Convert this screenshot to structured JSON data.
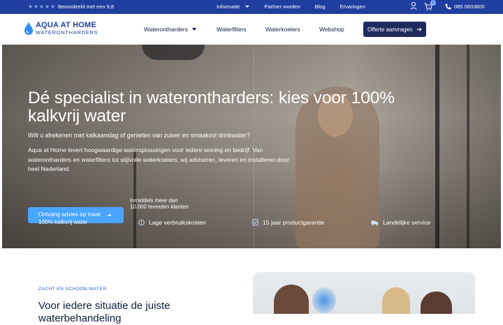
{
  "topbar": {
    "rating_text": "Beoordeeld met een 9,8",
    "stars": 5,
    "links": [
      {
        "label": "Informatie"
      },
      {
        "label": "Partner worden"
      },
      {
        "label": "Blog"
      },
      {
        "label": "Ervaringen"
      }
    ],
    "cart_count": "0",
    "phone": "085 0603800"
  },
  "header": {
    "logo_line1": "AQUA AT HOME",
    "logo_line2": "WATERONTHARDERS",
    "nav": [
      {
        "label": "Waterontharders"
      },
      {
        "label": "Waterfilters"
      },
      {
        "label": "Waterkoelers"
      },
      {
        "label": "Webshop"
      }
    ],
    "cta_label": "Offerte aanvragen"
  },
  "hero": {
    "title": "Dé specialist in waterontharders: kies voor 100% kalkvrij water",
    "subtitle": "Wilt u afrekenen met kalkaanslag of genieten van zuiver en smaakvol drinkwater?",
    "body": "Aqua at Home levert hoogwaardige wateroplossingen voor iedere woning en bedrijf. Van waterontharders en waterfilters tot stijlvolle waterkoelers: wij adviseren, leveren en installeren door heel Nederland.",
    "button_line1": "Ontvang advies op maat",
    "button_line2": "100% kalkvrij water",
    "happy_customers_line1": "Inmiddels meer dan",
    "happy_customers_line2": "10.000 tevreden klanten",
    "usps": [
      {
        "label": "Lage verbruikskosten",
        "icon": "coin-icon"
      },
      {
        "label": "15 jaar productgarantie",
        "icon": "warranty-icon"
      },
      {
        "label": "Landelijke service",
        "icon": "truck-icon"
      }
    ]
  },
  "section": {
    "eyebrow": "ZACHT EN SCHOON WATER",
    "title": "Voor iedere situatie de juiste waterbehandeling"
  },
  "colors": {
    "brand_dark": "#1f3ea0",
    "cta_dark": "#1f2a5e",
    "accent_blue": "#4aa5ff"
  }
}
